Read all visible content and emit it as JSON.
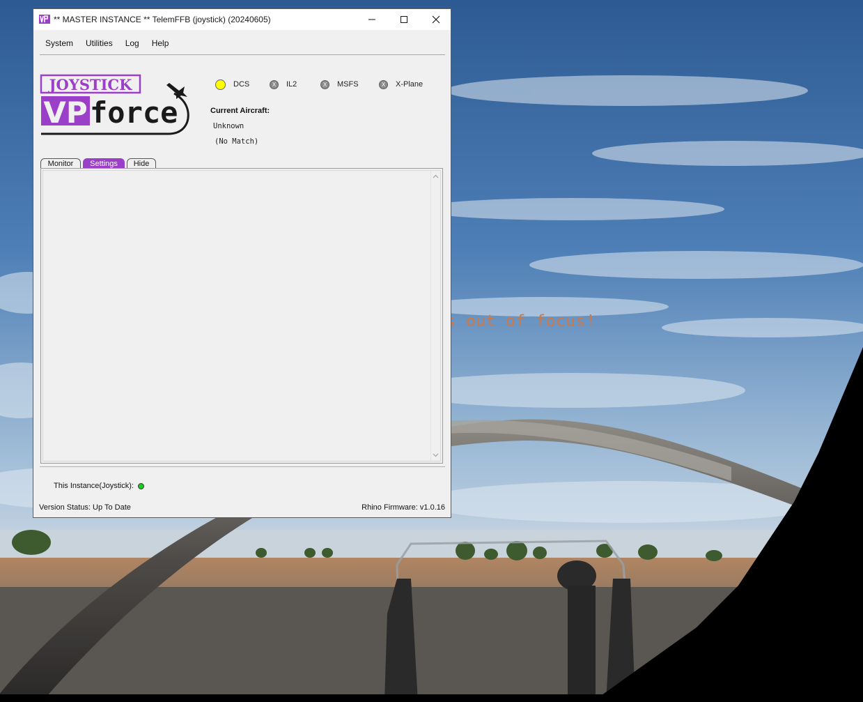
{
  "background": {
    "overlay_message": "s out of focus!"
  },
  "window": {
    "title": "** MASTER INSTANCE ** TelemFFB (joystick) (20240605)",
    "controls": [
      "minimize-icon",
      "maximize-icon",
      "close-icon"
    ]
  },
  "menu": {
    "items": [
      {
        "label": "System"
      },
      {
        "label": "Utilities"
      },
      {
        "label": "Log"
      },
      {
        "label": "Help"
      }
    ]
  },
  "logo": {
    "top_text": "JOYSTICK",
    "brand_vp": "VP",
    "brand_force": "force",
    "accent_color": "#9b3fc9"
  },
  "sims": [
    {
      "label": "DCS",
      "state": "active",
      "color": "#ffff00"
    },
    {
      "label": "IL2",
      "state": "off",
      "glyph": "X"
    },
    {
      "label": "MSFS",
      "state": "off",
      "glyph": "X"
    },
    {
      "label": "X-Plane",
      "state": "off",
      "glyph": "X"
    }
  ],
  "aircraft": {
    "label": "Current Aircraft:",
    "name": "Unknown",
    "match": "(No Match)"
  },
  "tabs": [
    {
      "label": "Monitor",
      "selected": false
    },
    {
      "label": "Settings",
      "selected": true
    },
    {
      "label": "Hide",
      "selected": false
    }
  ],
  "footer": {
    "instance_label": "This Instance(Joystick):",
    "instance_status_color": "#16d016",
    "version_status": "Version Status: Up To Date",
    "firmware": "Rhino Firmware: v1.0.16"
  }
}
